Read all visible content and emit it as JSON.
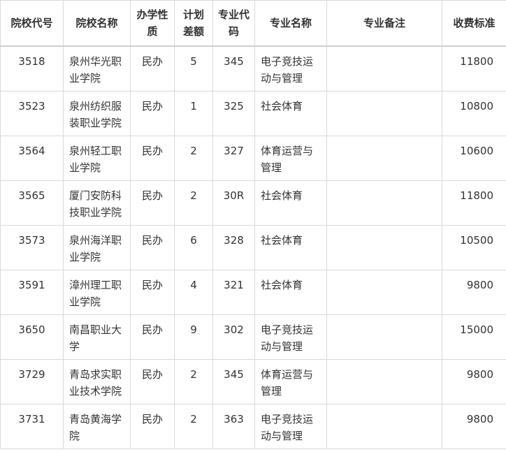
{
  "table": {
    "headers": {
      "code": "院校代号",
      "name": "院校名称",
      "type": "办学性质",
      "quota": "计划差额",
      "major_code": "专业代码",
      "major_name": "专业名称",
      "remark": "专业备注",
      "fee": "收费标准"
    },
    "rows": [
      {
        "code": "3518",
        "name": "泉州华光职业学院",
        "type": "民办",
        "quota": "5",
        "major_code": "345",
        "major_name": "电子竞技运动与管理",
        "remark": "",
        "fee": "11800"
      },
      {
        "code": "3523",
        "name": "泉州纺织服装职业学院",
        "type": "民办",
        "quota": "1",
        "major_code": "325",
        "major_name": "社会体育",
        "remark": "",
        "fee": "10800"
      },
      {
        "code": "3564",
        "name": "泉州轻工职业学院",
        "type": "民办",
        "quota": "2",
        "major_code": "327",
        "major_name": "体育运营与管理",
        "remark": "",
        "fee": "10600"
      },
      {
        "code": "3565",
        "name": "厦门安防科技职业学院",
        "type": "民办",
        "quota": "2",
        "major_code": "30R",
        "major_name": "社会体育",
        "remark": "",
        "fee": "11800"
      },
      {
        "code": "3573",
        "name": "泉州海洋职业学院",
        "type": "民办",
        "quota": "6",
        "major_code": "328",
        "major_name": "社会体育",
        "remark": "",
        "fee": "10500"
      },
      {
        "code": "3591",
        "name": "漳州理工职业学院",
        "type": "民办",
        "quota": "4",
        "major_code": "321",
        "major_name": "社会体育",
        "remark": "",
        "fee": "9800"
      },
      {
        "code": "3650",
        "name": "南昌职业大学",
        "type": "民办",
        "quota": "9",
        "major_code": "302",
        "major_name": "电子竞技运动与管理",
        "remark": "",
        "fee": "15000"
      },
      {
        "code": "3729",
        "name": "青岛求实职业技术学院",
        "type": "民办",
        "quota": "2",
        "major_code": "345",
        "major_name": "体育运营与管理",
        "remark": "",
        "fee": "9800"
      },
      {
        "code": "3731",
        "name": "青岛黄海学院",
        "type": "民办",
        "quota": "2",
        "major_code": "363",
        "major_name": "电子竞技运动与管理",
        "remark": "",
        "fee": "9800"
      }
    ]
  }
}
